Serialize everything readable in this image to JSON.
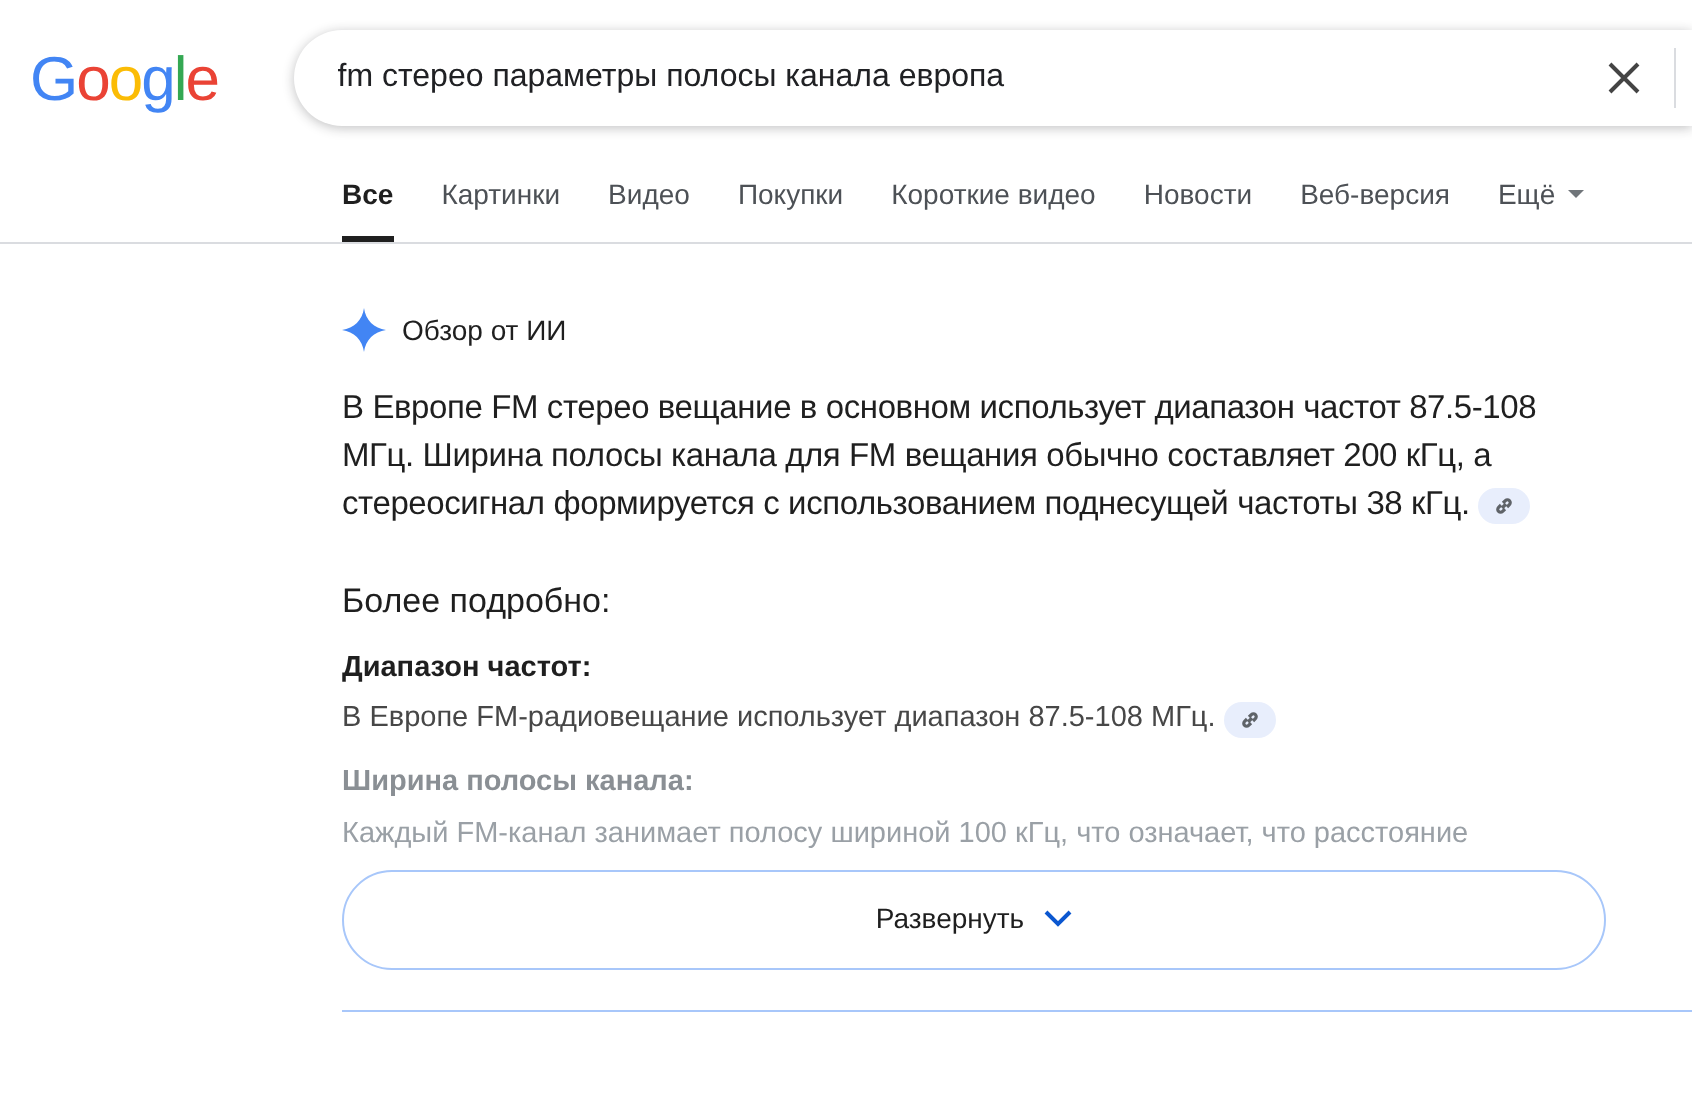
{
  "logo": "Google",
  "search": {
    "value": "fm стерео параметры полосы канала европа"
  },
  "tabs": [
    {
      "label": "Все",
      "selected": true
    },
    {
      "label": "Картинки",
      "selected": false
    },
    {
      "label": "Видео",
      "selected": false
    },
    {
      "label": "Покупки",
      "selected": false
    },
    {
      "label": "Короткие видео",
      "selected": false
    },
    {
      "label": "Новости",
      "selected": false
    },
    {
      "label": "Веб-версия",
      "selected": false
    },
    {
      "label": "Ещё",
      "selected": false,
      "kind": "menu"
    }
  ],
  "overview": {
    "title": "Обзор от ИИ",
    "summary": {
      "text": "В Европе FM стерео вещание в основном использует диапазон частот 87.5-108 МГц. Ширина полосы канала для FM вещания обычно составляет 200 кГц, а стереосигнал формируется с использованием поднесущей частоты 38 кГц.",
      "has_link": true
    },
    "details_heading": "Более подробно:",
    "sections": [
      {
        "heading": "Диапазон частот:",
        "text": "В Европе FM-радиовещание использует диапазон 87.5-108 МГц.",
        "has_link": true,
        "faded": false
      },
      {
        "heading": "Ширина полосы канала:",
        "text": "Каждый FM-канал занимает полосу шириной 100 кГц, что означает, что расстояние",
        "has_link": false,
        "faded": true
      }
    ],
    "expand_button": "Развернуть"
  }
}
